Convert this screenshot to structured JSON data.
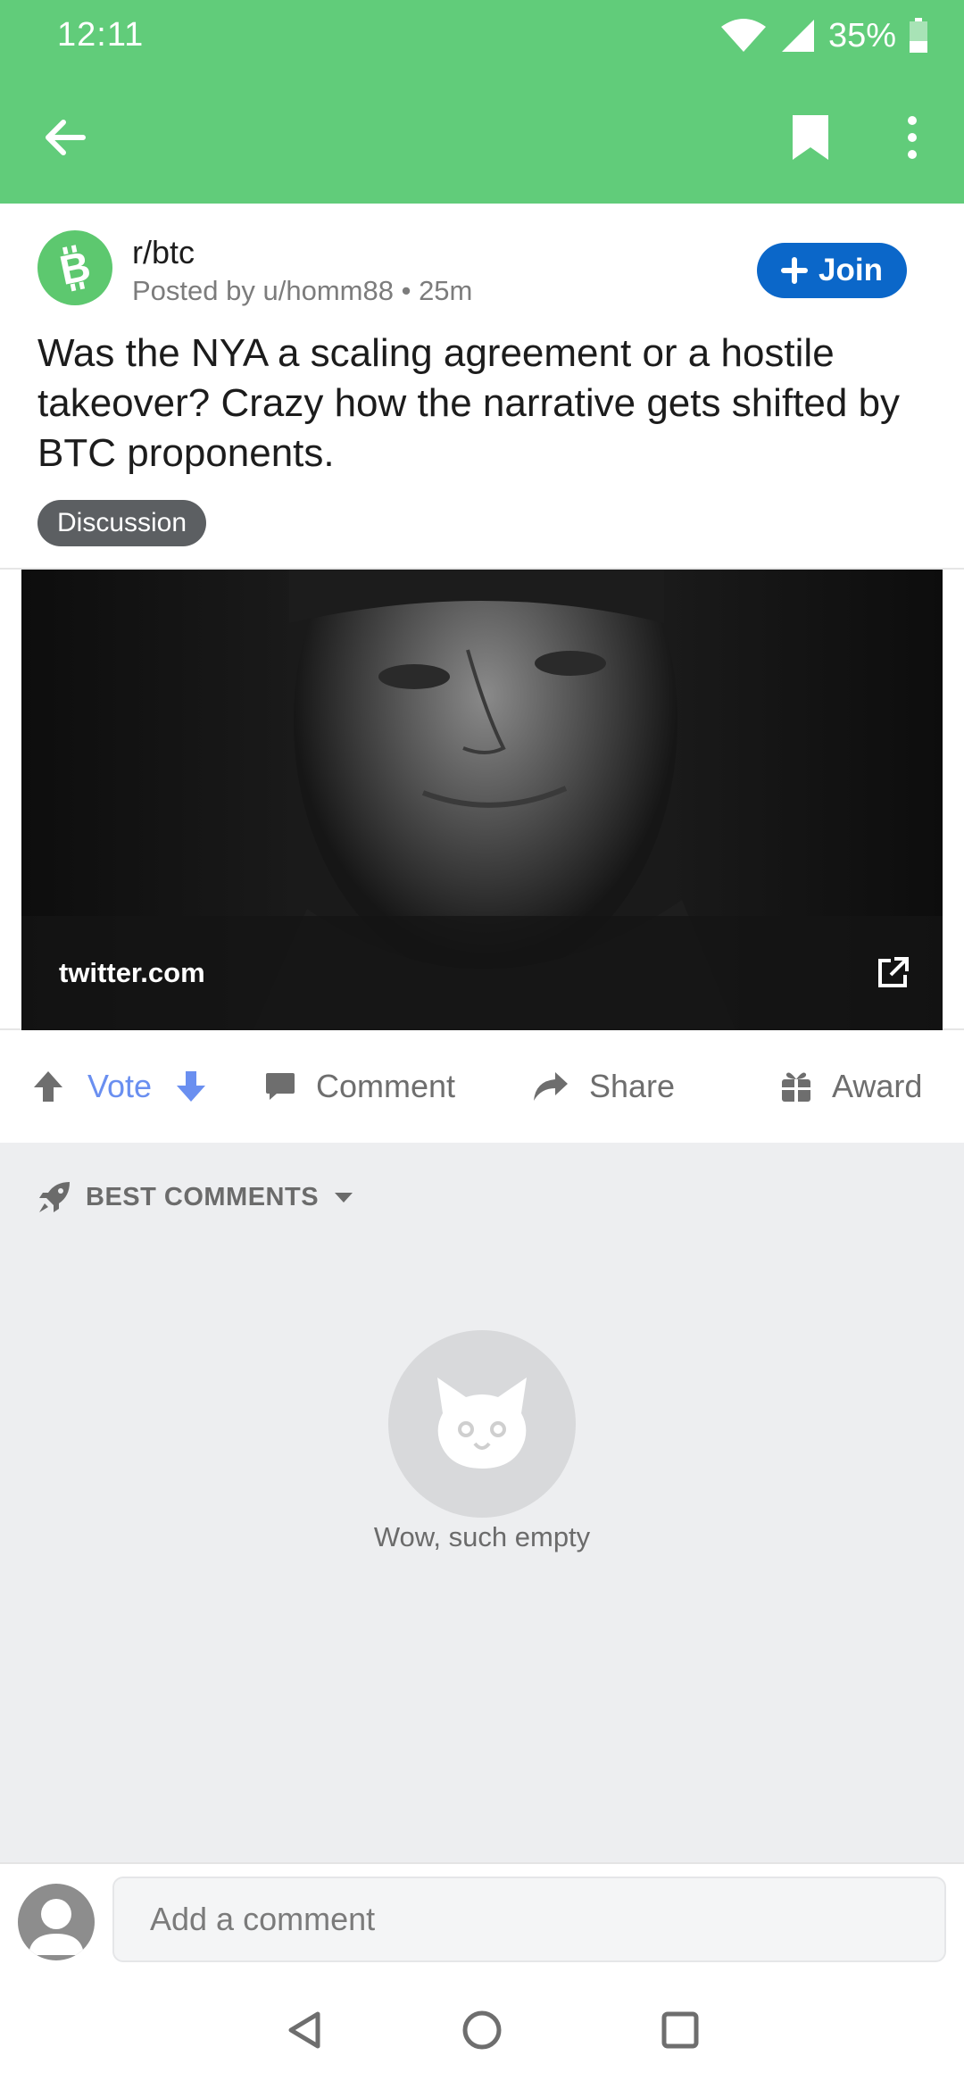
{
  "status_bar": {
    "time": "12:11",
    "battery": "35%"
  },
  "app_bar": {
    "back_icon": "arrow-left-icon",
    "save_icon": "bookmark-icon",
    "more_icon": "more-vertical-icon"
  },
  "post": {
    "subreddit": "r/btc",
    "posted_by": "Posted by u/homm88",
    "separator": "•",
    "time_ago": "25m",
    "join_label": "Join",
    "title": "Was the NYA a scaling agreement or a hostile takeover? Crazy how the narrative gets shifted by BTC proponents.",
    "flair": "Discussion",
    "link_domain": "twitter.com"
  },
  "actions": {
    "vote": "Vote",
    "comment": "Comment",
    "share": "Share",
    "award": "Award"
  },
  "comments": {
    "sort_label": "BEST COMMENTS",
    "empty_text": "Wow, such empty"
  },
  "composer": {
    "placeholder": "Add a comment"
  },
  "colors": {
    "header_green": "#61cc7a",
    "join_blue": "#0b67c9",
    "vote_blue": "#6a8ff0",
    "flair_gray": "#5c5f62"
  }
}
